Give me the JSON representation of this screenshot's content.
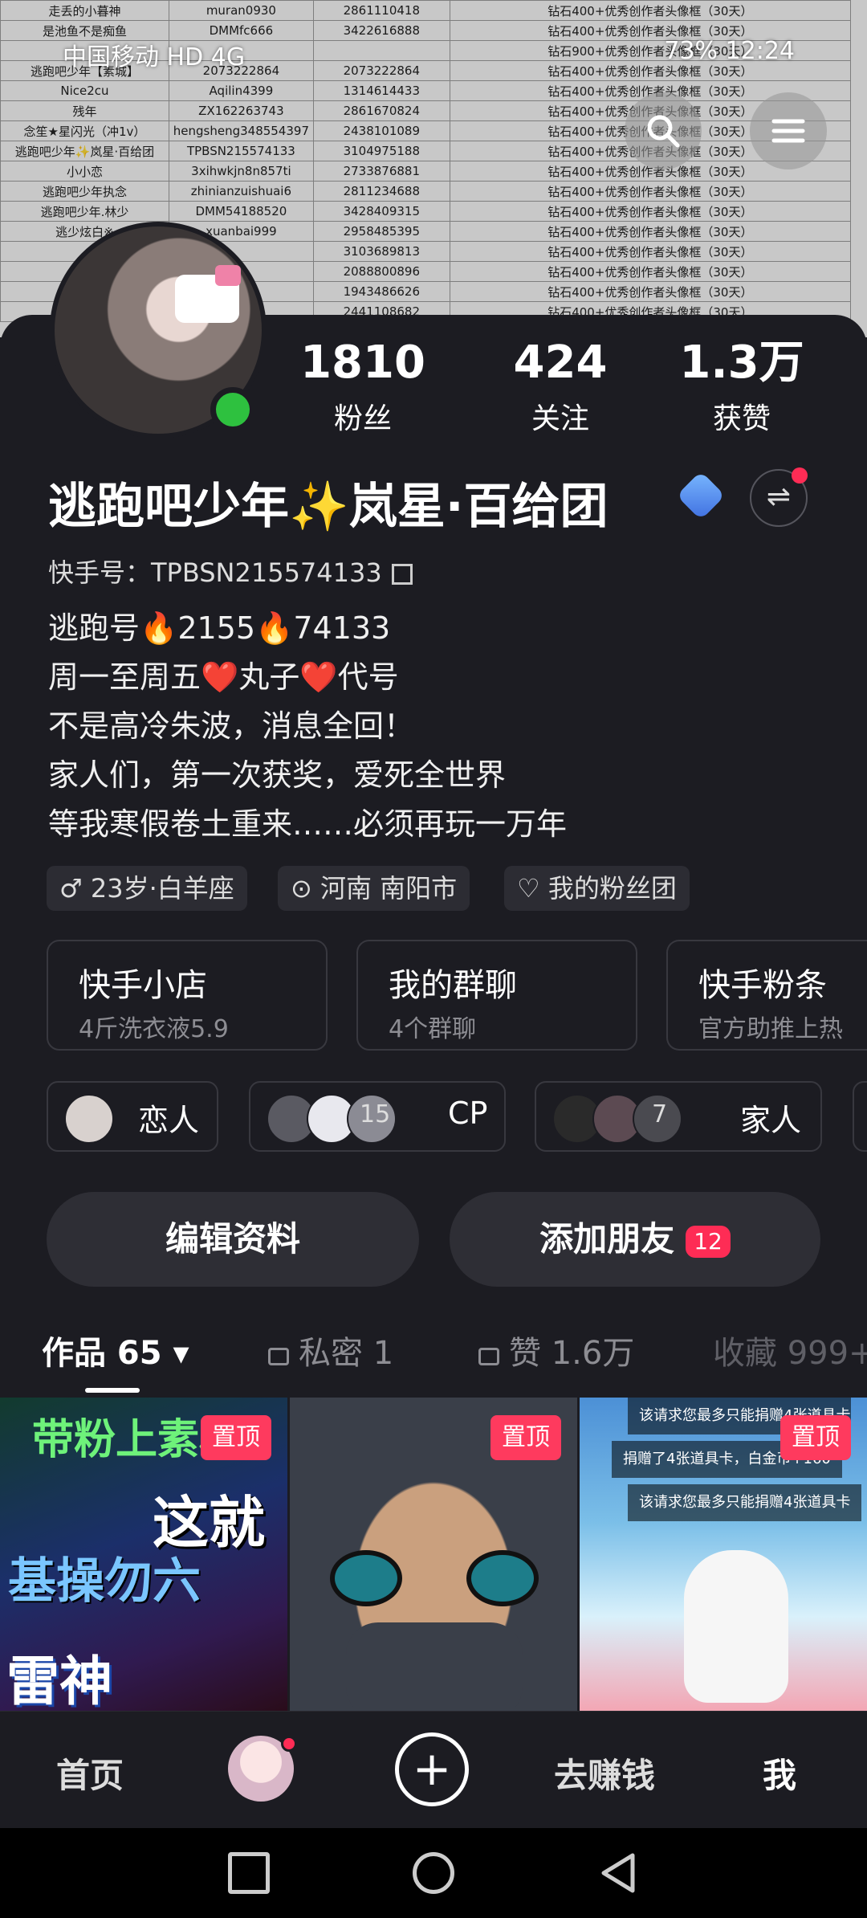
{
  "status_bar": {
    "carrier": "中国移动 HD 4G",
    "right": "73% 12:24"
  },
  "spreadsheet_rows": [
    [
      "走丢的小暮神",
      "muran0930",
      "2861110418",
      "钻石400+优秀创作者头像框（30天）"
    ],
    [
      "是池鱼不是痴鱼",
      "DMMfc666",
      "3422616888",
      "钻石400+优秀创作者头像框（30天）"
    ],
    [
      "",
      "",
      "",
      "钻石900+优秀创作者头像框（30天）"
    ],
    [
      "逃跑吧少年【素城】",
      "2073222864",
      "2073222864",
      "钻石400+优秀创作者头像框（30天）"
    ],
    [
      "Nice2cu",
      "Aqilin4399",
      "1314614433",
      "钻石400+优秀创作者头像框（30天）"
    ],
    [
      "残年",
      "ZX162263743",
      "2861670824",
      "钻石400+优秀创作者头像框（30天）"
    ],
    [
      "念笙★星闪光（冲1v）",
      "hengsheng348554397",
      "2438101089",
      "钻石400+优秀创作者头像框（30天）"
    ],
    [
      "逃跑吧少年✨岚星·百给团",
      "TPBSN215574133",
      "3104975188",
      "钻石400+优秀创作者头像框（30天）"
    ],
    [
      "小小恋",
      "3xihwkjn8n857ti",
      "2733876881",
      "钻石400+优秀创作者头像框（30天）"
    ],
    [
      "逃跑吧少年执念",
      "zhinianzuishuai6",
      "2811234688",
      "钻石400+优秀创作者头像框（30天）"
    ],
    [
      "逃跑吧少年.林少",
      "DMM54188520",
      "3428409315",
      "钻石400+优秀创作者头像框（30天）"
    ],
    [
      "逃少炫白※",
      "xuanbai999",
      "2958485395",
      "钻石400+优秀创作者头像框（30天）"
    ],
    [
      "",
      "",
      "3103689813",
      "钻石400+优秀创作者头像框（30天）"
    ],
    [
      "",
      "",
      "2088800896",
      "钻石400+优秀创作者头像框（30天）"
    ],
    [
      "",
      "",
      "1943486626",
      "钻石400+优秀创作者头像框（30天）"
    ],
    [
      "",
      "",
      "2441108682",
      "钻石400+优秀创作者头像框（30天）"
    ]
  ],
  "profile": {
    "stats": [
      {
        "value": "1810",
        "label": "粉丝"
      },
      {
        "value": "424",
        "label": "关注"
      },
      {
        "value": "1.3万",
        "label": "获赞"
      }
    ],
    "nickname": "逃跑吧少年✨岚星·百给团",
    "kuaishou_id": "快手号：TPBSN215574133",
    "bio": [
      "逃跑号🔥2155🔥74133",
      "周一至周五❤️丸子❤️代号",
      "不是高冷朱波，消息全回！",
      "家人们，第一次获奖，爱死全世界",
      "等我寒假卷土重来……必须再玩一万年"
    ],
    "tags": {
      "age": "♂ 23岁·白羊座",
      "location": "河南 南阳市",
      "fan_group": "我的粉丝团"
    },
    "cards": [
      {
        "title": "快手小店",
        "subtitle": "4斤洗衣液5.9"
      },
      {
        "title": "我的群聊",
        "subtitle": "4个群聊"
      },
      {
        "title": "快手粉条",
        "subtitle": "官方助推上热"
      }
    ],
    "relations": {
      "lover": "恋人",
      "cp_count": "15",
      "cp": "CP",
      "family_count": "7",
      "family": "家人"
    },
    "actions": {
      "edit": "编辑资料",
      "add_friend": "添加朋友",
      "add_friend_badge": "12"
    }
  },
  "tabs": {
    "works": "作品 65 ▾",
    "private": "私密 1",
    "liked": "赞 1.6万",
    "favorites": "收藏 999+"
  },
  "posts": {
    "pin_label": "置顶",
    "p1": {
      "line1": "带粉上素材",
      "line2": "这就",
      "line3": "基操勿六",
      "line4": "雷神"
    },
    "p3": {
      "line1": "该请求您最多只能捐赠4张道具卡",
      "line2": "捐赠了4张道具卡，白金币+160",
      "line3": "该请求您最多只能捐赠4张道具卡"
    }
  },
  "bottom_nav": {
    "home": "首页",
    "create": "+",
    "earn": "去赚钱",
    "me": "我"
  }
}
